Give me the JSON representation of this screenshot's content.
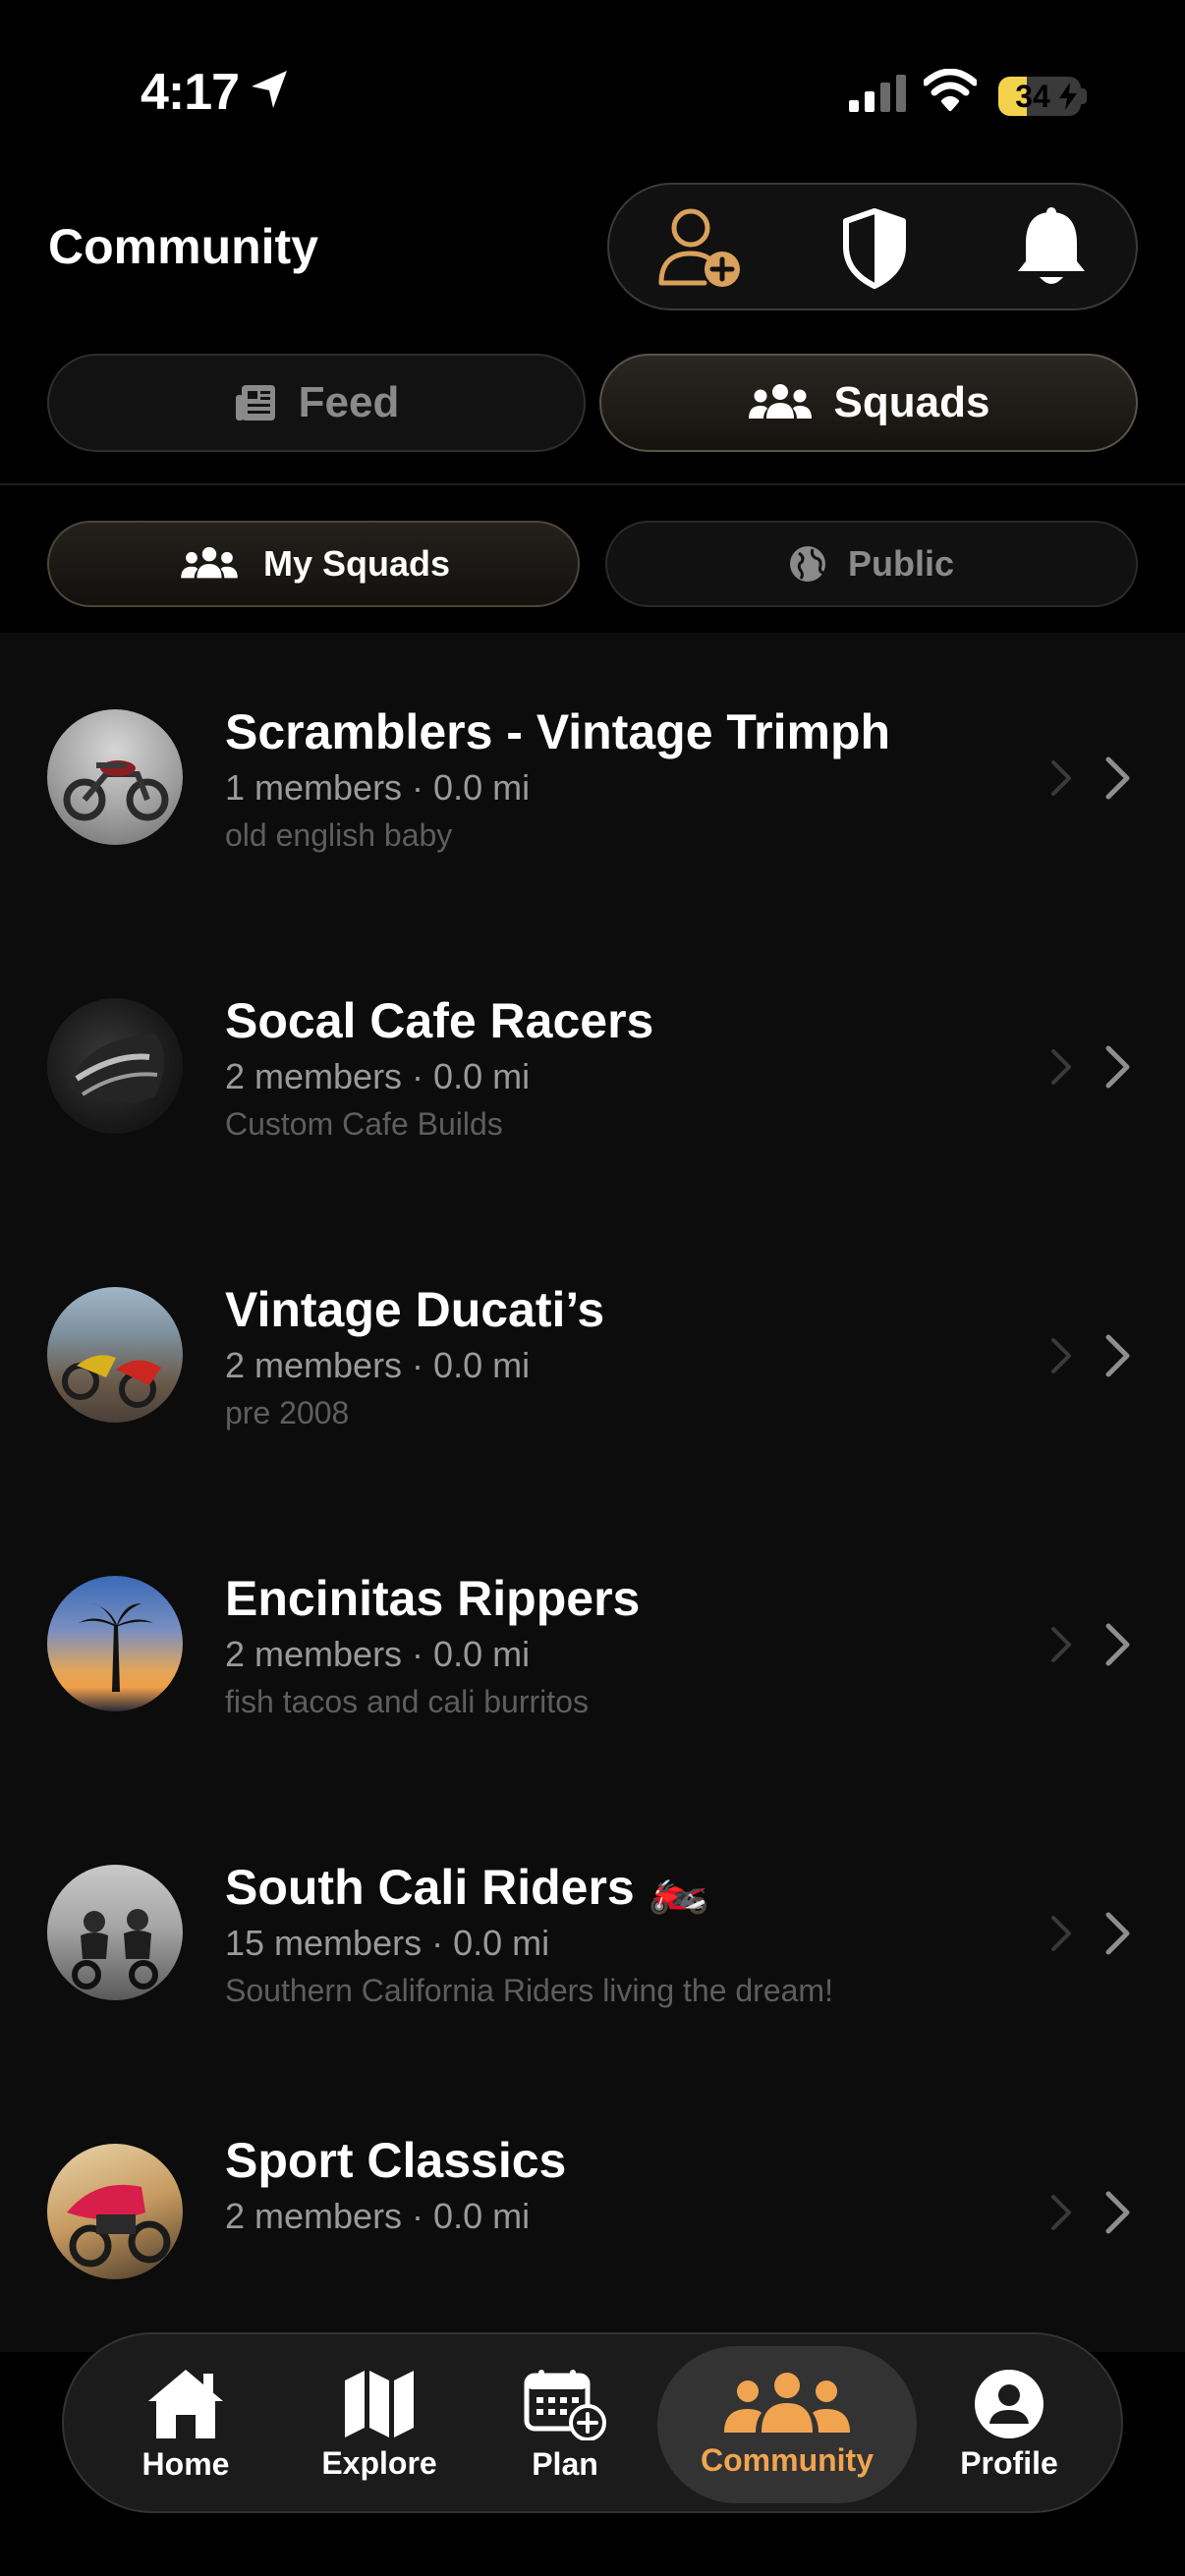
{
  "status_bar": {
    "time": "4:17",
    "battery_percent": "34",
    "battery_level": 0.34
  },
  "header": {
    "title": "Community"
  },
  "tabs": {
    "feed": "Feed",
    "squads": "Squads",
    "active": "Squads"
  },
  "subtabs": {
    "my_squads": "My Squads",
    "public": "Public",
    "active": "My Squads"
  },
  "squads": [
    {
      "name": "Scramblers - Vintage Trimph",
      "meta": "1 members · 0.0 mi",
      "description": "old english baby"
    },
    {
      "name": "Socal Cafe Racers",
      "meta": "2 members · 0.0 mi",
      "description": "Custom Cafe Builds"
    },
    {
      "name": "Vintage Ducati’s",
      "meta": "2 members · 0.0 mi",
      "description": "pre 2008"
    },
    {
      "name": "Encinitas Rippers",
      "meta": "2 members · 0.0 mi",
      "description": "fish tacos and cali burritos"
    },
    {
      "name": "South Cali Riders 🏍️",
      "meta": "15 members · 0.0 mi",
      "description": "Southern California Riders living the dream!"
    },
    {
      "name": "Sport Classics",
      "meta": "2 members · 0.0 mi",
      "description": ""
    }
  ],
  "nav": {
    "home": "Home",
    "explore": "Explore",
    "plan": "Plan",
    "community": "Community",
    "profile": "Profile",
    "active": "Community"
  },
  "colors": {
    "accent": "#F0A450",
    "icon_gold": "#D9A15C",
    "background": "#000000",
    "list_background": "#0C0C0C",
    "battery": "#F2D24B"
  },
  "icons": {
    "header": [
      "add-friend-icon",
      "shield-icon",
      "bell-icon"
    ],
    "tabs": [
      "newspaper-icon",
      "people-icon"
    ],
    "subtabs": [
      "people-icon",
      "globe-icon"
    ],
    "row": "chevron-right-icon",
    "nav": [
      "home-icon",
      "map-icon",
      "calendar-add-icon",
      "people-icon",
      "user-circle-icon"
    ]
  }
}
